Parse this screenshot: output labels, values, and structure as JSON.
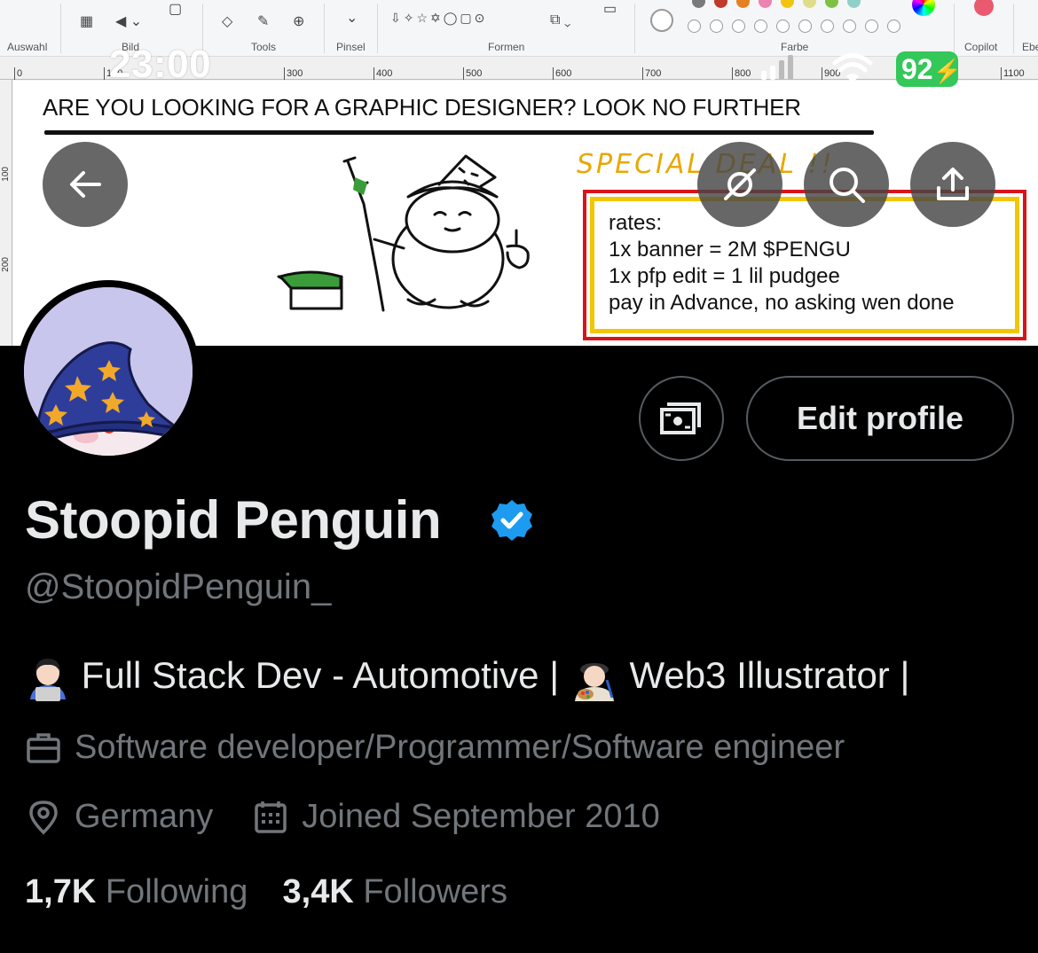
{
  "paint": {
    "ribbon_groups": [
      "Auswahl",
      "Bild",
      "Tools",
      "Pinsel",
      "Formen",
      "Farbe",
      "Copilot",
      "Ebe"
    ],
    "ruler_ticks": [
      "0",
      "100",
      "300",
      "400",
      "500",
      "600",
      "700",
      "800",
      "900",
      "1100"
    ],
    "vruler_ticks": [
      "100",
      "200"
    ],
    "swatch_colors": [
      "#7a7a7a",
      "#c0392b",
      "#e67e22",
      "#ec82b0",
      "#f1c40f",
      "#e0dd8a",
      "#7dc242",
      "#8fd0c8"
    ]
  },
  "banner": {
    "headline": "ARE YOU LOOKING FOR A GRAPHIC DESIGNER? LOOK NO FURTHER",
    "special": "SPECIAL DEAL !!",
    "rates": [
      "rates:",
      "1x banner = 2M $PENGU",
      "1x pfp edit = 1 lil pudgee",
      "pay in Advance, no asking wen done"
    ]
  },
  "status_bar": {
    "time": "23:00",
    "battery": "92"
  },
  "profile": {
    "name": "Stoopid Penguin",
    "handle": "@StoopidPenguin_",
    "bio_part1": "Full Stack Dev - Automotive |",
    "bio_part2": "Web3 Illustrator |",
    "profession": "Software developer/Programmer/Software engineer",
    "location": "Germany",
    "joined": "Joined September 2010",
    "following_count": "1,7K",
    "following_label": "Following",
    "followers_count": "3,4K",
    "followers_label": "Followers",
    "edit_button": "Edit profile"
  },
  "colors": {
    "background": "#000000",
    "text_primary": "#e7e9ea",
    "text_secondary": "#71767b",
    "verified_blue": "#1d9bf0",
    "battery_green": "#34c759"
  },
  "icons": [
    "back-arrow-icon",
    "satellite-off-icon",
    "search-icon",
    "share-icon",
    "subscriptions-icon",
    "verified-badge-icon",
    "briefcase-icon",
    "location-pin-icon",
    "calendar-icon",
    "signal-icon",
    "wifi-icon",
    "battery-icon"
  ]
}
